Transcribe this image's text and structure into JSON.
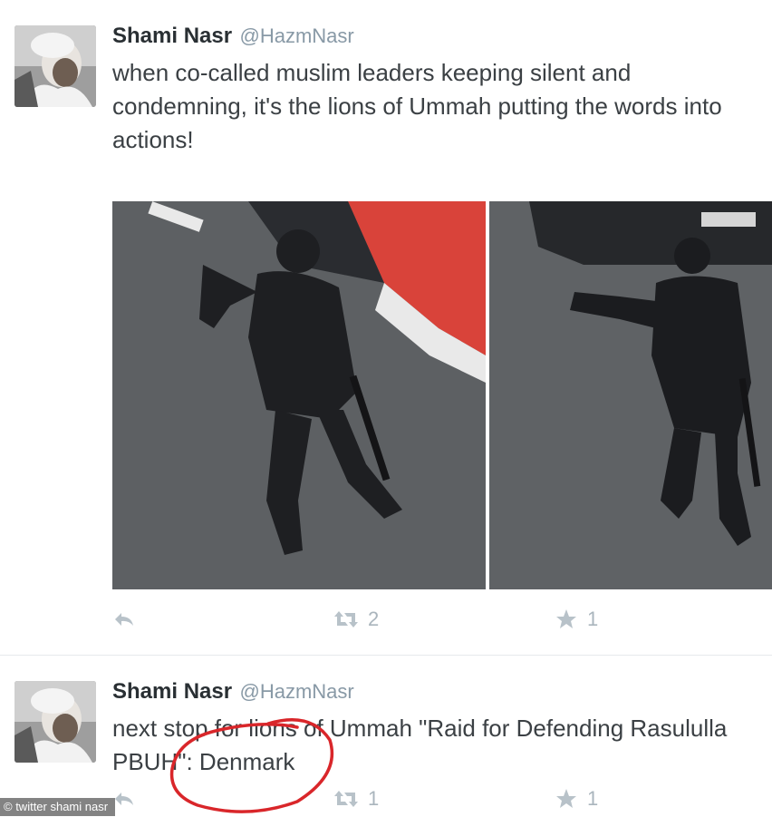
{
  "tweets": [
    {
      "name": "Shami Nasr",
      "handle": "@HazmNasr",
      "text": "when co-called muslim leaders keeping silent and condemning, it's the lions of Ummah putting the words into actions!",
      "retweets": "2",
      "favorites": "1",
      "icons": {
        "reply": "reply-icon",
        "retweet": "retweet-icon",
        "favorite": "star-icon"
      }
    },
    {
      "name": "Shami Nasr",
      "handle": "@HazmNasr",
      "text": "next stop for lions of Ummah \"Raid for Defending Rasululla PBUH\": Denmark",
      "retweets": "1",
      "favorites": "1",
      "icons": {
        "reply": "reply-icon",
        "retweet": "retweet-icon",
        "favorite": "star-icon"
      }
    }
  ],
  "credit": "© twitter shami nasr",
  "colors": {
    "annotation_circle": "#d9262a",
    "action_icons": "#b8c2c9",
    "handle": "#8899a6"
  }
}
